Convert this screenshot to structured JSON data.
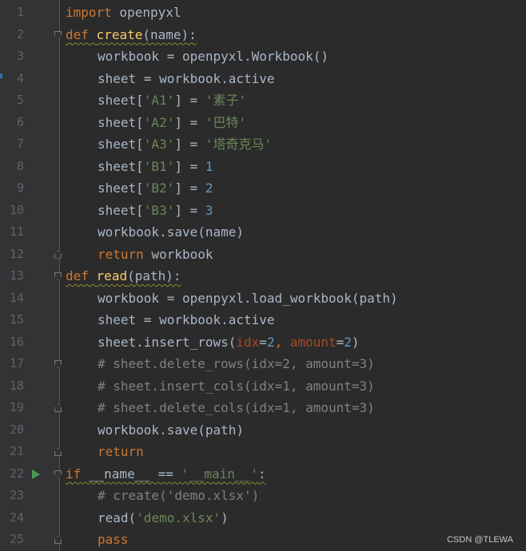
{
  "editor": {
    "lines": [
      {
        "n": "1",
        "parts": [
          [
            "kw",
            "import"
          ],
          [
            "plain",
            " openpyxl"
          ]
        ]
      },
      {
        "n": "2",
        "fold": "down",
        "parts": [
          [
            "kw",
            "def"
          ],
          [
            "plain",
            " "
          ],
          [
            "fn",
            "create"
          ],
          [
            "plain",
            "(name):"
          ]
        ],
        "squig": true
      },
      {
        "n": "3",
        "indent": 1,
        "parts": [
          [
            "plain",
            "workbook = openpyxl.Workbook()"
          ]
        ]
      },
      {
        "n": "4",
        "indent": 1,
        "parts": [
          [
            "plain",
            "sheet = workbook.active"
          ]
        ]
      },
      {
        "n": "5",
        "indent": 1,
        "parts": [
          [
            "plain",
            "sheet["
          ],
          [
            "str",
            "'A1'"
          ],
          [
            "plain",
            "] = "
          ],
          [
            "str",
            "'素子'"
          ]
        ]
      },
      {
        "n": "6",
        "indent": 1,
        "parts": [
          [
            "plain",
            "sheet["
          ],
          [
            "str",
            "'A2'"
          ],
          [
            "plain",
            "] = "
          ],
          [
            "str",
            "'巴特'"
          ]
        ]
      },
      {
        "n": "7",
        "indent": 1,
        "parts": [
          [
            "plain",
            "sheet["
          ],
          [
            "str",
            "'A3'"
          ],
          [
            "plain",
            "] = "
          ],
          [
            "str",
            "'塔奇克马'"
          ]
        ]
      },
      {
        "n": "8",
        "indent": 1,
        "parts": [
          [
            "plain",
            "sheet["
          ],
          [
            "str",
            "'B1'"
          ],
          [
            "plain",
            "] = "
          ],
          [
            "num",
            "1"
          ]
        ]
      },
      {
        "n": "9",
        "indent": 1,
        "parts": [
          [
            "plain",
            "sheet["
          ],
          [
            "str",
            "'B2'"
          ],
          [
            "plain",
            "] = "
          ],
          [
            "num",
            "2"
          ]
        ]
      },
      {
        "n": "10",
        "indent": 1,
        "parts": [
          [
            "plain",
            "sheet["
          ],
          [
            "str",
            "'B3'"
          ],
          [
            "plain",
            "] = "
          ],
          [
            "num",
            "3"
          ]
        ]
      },
      {
        "n": "11",
        "indent": 1,
        "parts": [
          [
            "plain",
            "workbook.save(name)"
          ]
        ]
      },
      {
        "n": "12",
        "indent": 1,
        "fold": "up",
        "parts": [
          [
            "kw",
            "return"
          ],
          [
            "plain",
            " workbook"
          ]
        ]
      },
      {
        "n": "13",
        "fold": "down",
        "parts": [
          [
            "kw",
            "def"
          ],
          [
            "plain",
            " "
          ],
          [
            "fn",
            "read"
          ],
          [
            "plain",
            "(path):"
          ]
        ],
        "squig": true
      },
      {
        "n": "14",
        "indent": 1,
        "parts": [
          [
            "plain",
            "workbook = openpyxl.load_workbook(path)"
          ]
        ]
      },
      {
        "n": "15",
        "indent": 1,
        "parts": [
          [
            "plain",
            "sheet = workbook.active"
          ]
        ]
      },
      {
        "n": "16",
        "indent": 1,
        "parts": [
          [
            "plain",
            "sheet.insert_rows("
          ],
          [
            "param",
            "idx"
          ],
          [
            "plain",
            "="
          ],
          [
            "num",
            "2"
          ],
          [
            "kw",
            ", "
          ],
          [
            "param",
            "amount"
          ],
          [
            "plain",
            "="
          ],
          [
            "num",
            "2"
          ],
          [
            "plain",
            ")"
          ]
        ]
      },
      {
        "n": "17",
        "indent": 1,
        "fold": "down",
        "parts": [
          [
            "cmt",
            "# sheet.delete_rows(idx=2, amount=3)"
          ]
        ]
      },
      {
        "n": "18",
        "indent": 1,
        "parts": [
          [
            "cmt",
            "# sheet.insert_cols(idx=1, amount=3)"
          ]
        ]
      },
      {
        "n": "19",
        "indent": 1,
        "fold": "up",
        "parts": [
          [
            "cmt",
            "# sheet.delete_cols(idx=1, amount=3)"
          ]
        ]
      },
      {
        "n": "20",
        "indent": 1,
        "parts": [
          [
            "plain",
            "workbook.save(path)"
          ]
        ]
      },
      {
        "n": "21",
        "indent": 1,
        "fold": "up",
        "parts": [
          [
            "kw",
            "return"
          ]
        ]
      },
      {
        "n": "22",
        "run": true,
        "fold": "down",
        "parts": [
          [
            "kw",
            "if"
          ],
          [
            "plain",
            " __name__ == "
          ],
          [
            "str",
            "'__main__'"
          ],
          [
            "plain",
            ":"
          ]
        ],
        "squig": true
      },
      {
        "n": "23",
        "indent": 1,
        "parts": [
          [
            "cmt",
            "# create('demo.xlsx')"
          ]
        ]
      },
      {
        "n": "24",
        "indent": 1,
        "parts": [
          [
            "plain",
            "read("
          ],
          [
            "str",
            "'demo.xlsx'"
          ],
          [
            "plain",
            ")"
          ]
        ]
      },
      {
        "n": "25",
        "indent": 1,
        "fold": "up",
        "parts": [
          [
            "kw",
            "pass"
          ]
        ]
      }
    ]
  },
  "watermark": "CSDN @TLEWA",
  "colors": {
    "background": "#2b2b2b",
    "gutter": "#313335",
    "keyword": "#cc7832",
    "function": "#ffc66d",
    "string": "#6a8759",
    "number": "#6897bb",
    "comment": "#808080",
    "param": "#aa4926",
    "text": "#a9b7c6",
    "run_icon": "#499c54"
  },
  "icons": [
    "run-gutter-icon",
    "fold-marker-icon"
  ]
}
